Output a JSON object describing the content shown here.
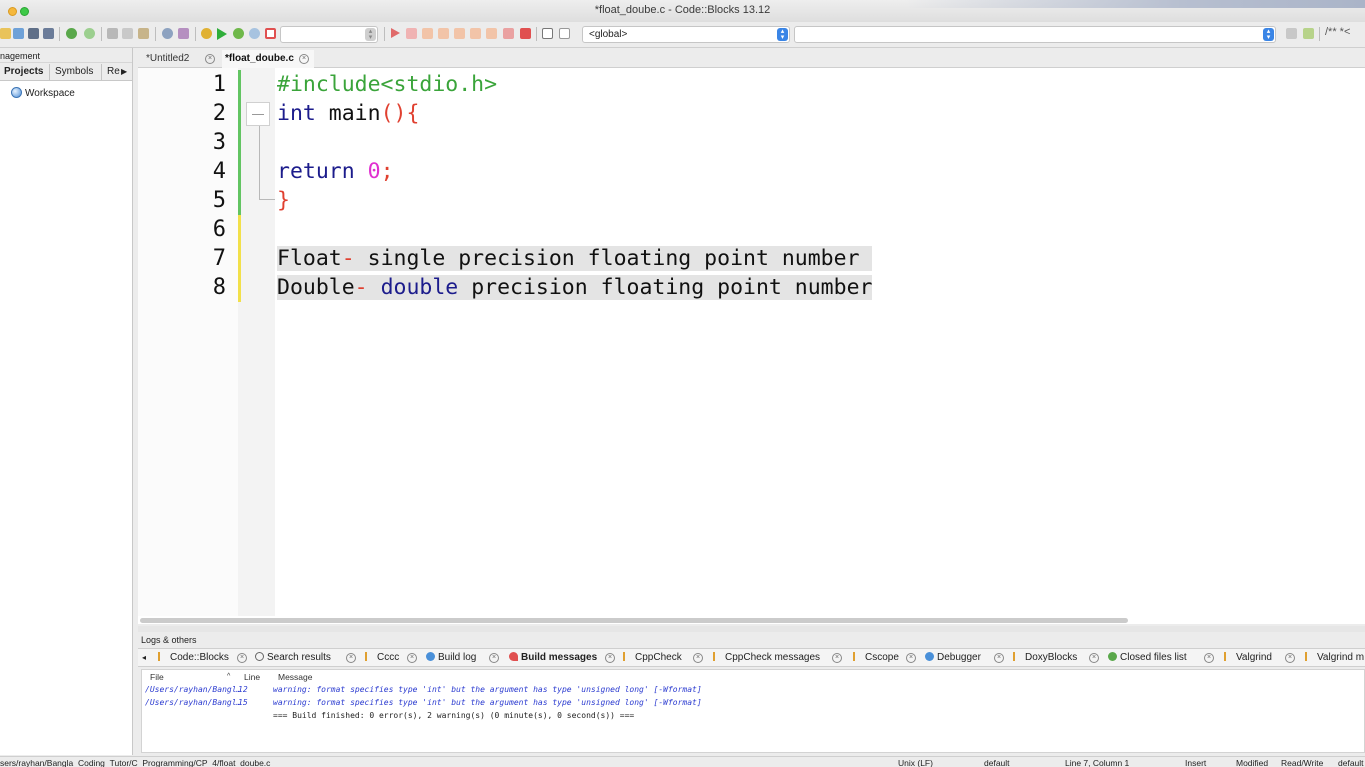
{
  "window": {
    "title": "*float_doube.c - Code::Blocks 13.12"
  },
  "toolbar": {
    "scope_select": "<global>",
    "comment_hint": "/** *<"
  },
  "management": {
    "title": "nagement",
    "tabs": [
      "Projects",
      "Symbols",
      "Re"
    ],
    "workspace": "Workspace"
  },
  "editor_tabs": [
    "*Untitled2",
    "*float_doube.c"
  ],
  "editor": {
    "line_numbers": [
      "1",
      "2",
      "3",
      "4",
      "5",
      "6",
      "7",
      "8"
    ],
    "line1": "#include<stdio.h>",
    "line2_kw": "int",
    "line2_fn": " main",
    "line2_br": "(){",
    "line4_kw": "return",
    "line4_num": "0",
    "line4_semi": ";",
    "line5_br": "}",
    "line7_a": "Float",
    "line7_b": "-",
    "line7_c": " single precision floating point number ",
    "line8_a": "Double",
    "line8_b": "-",
    "line8_c": " ",
    "line8_kw": "double",
    "line8_d": " precision floating point number"
  },
  "logs": {
    "title": "Logs & others",
    "tabs": [
      "Code::Blocks",
      "Search results",
      "Cccc",
      "Build log",
      "Build messages",
      "CppCheck",
      "CppCheck messages",
      "Cscope",
      "Debugger",
      "DoxyBlocks",
      "Closed files list",
      "Valgrind",
      "Valgrind m"
    ],
    "columns": [
      "File",
      "Line",
      "Message"
    ],
    "rows": [
      {
        "file": "/Users/rayhan/Bangl…",
        "line": "12",
        "message": "warning: format specifies type 'int' but the argument has type 'unsigned long' [-Wformat]"
      },
      {
        "file": "/Users/rayhan/Bangl…",
        "line": "15",
        "message": "warning: format specifies type 'int' but the argument has type 'unsigned long' [-Wformat]"
      },
      {
        "file": "",
        "line": "",
        "message": "=== Build finished: 0 error(s), 2 warning(s) (0 minute(s), 0 second(s)) ==="
      }
    ]
  },
  "status": {
    "path": "sers/rayhan/Bangla_Coding_Tutor/C_Programming/CP_4/float_doube.c",
    "eol": "Unix (LF)",
    "encoding": "default",
    "position": "Line 7, Column 1",
    "mode": "Insert",
    "modified": "Modified",
    "access": "Read/Write",
    "lang": "default"
  },
  "colors": {
    "preprocessor": "#3aa43a",
    "keyword": "#1c1c8c",
    "brace": "#e04030",
    "number": "#e030d0",
    "selection": "#e4e4e4"
  }
}
